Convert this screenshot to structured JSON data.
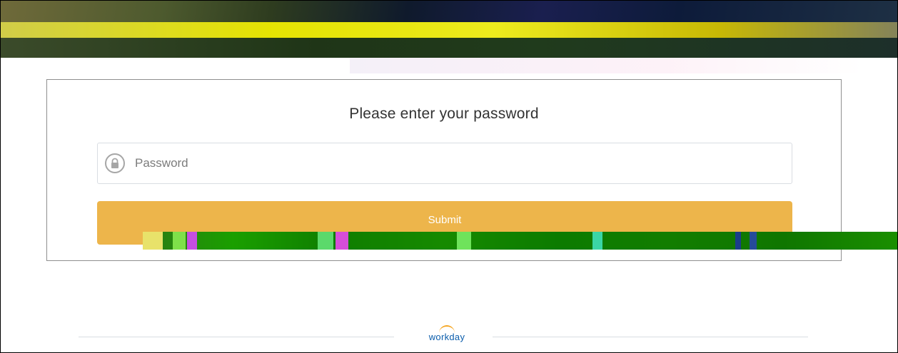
{
  "login": {
    "title": "Please enter your password",
    "password_placeholder": "Password",
    "submit_label": "Submit"
  },
  "footer": {
    "brand": "workday"
  },
  "colors": {
    "submit_bg": "#EDB54B",
    "brand_blue": "#0B5DAB",
    "brand_arc": "#F5A623"
  },
  "icons": {
    "password_field": "lock-icon",
    "brand": "workday-logo"
  }
}
